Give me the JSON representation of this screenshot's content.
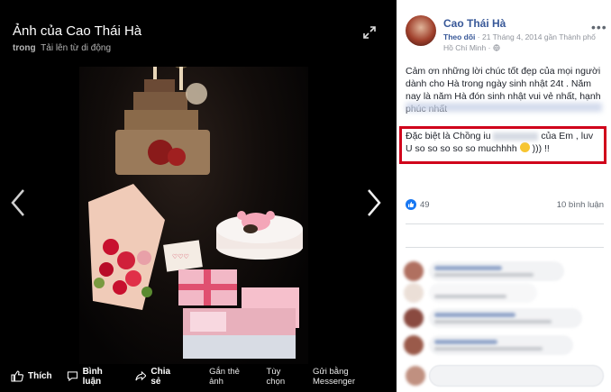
{
  "viewer": {
    "title": "Ảnh của Cao Thái Hà",
    "subtitle_prefix": "trong",
    "subtitle_link": "Tải lên từ di động",
    "actions": {
      "like": "Thích",
      "comment": "Bình luận",
      "share": "Chia sẻ"
    },
    "right_actions": {
      "tag": "Gắn thẻ ảnh",
      "options": "Tùy chọn",
      "messenger": "Gửi bằng Messenger"
    }
  },
  "post": {
    "author": "Cao Thái Hà",
    "follow": "Theo dõi",
    "meta": "· 21 Tháng 4, 2014 gần Thành phố Hồ Chí Minh ·",
    "more": "•••",
    "text": "Cảm ơn những lời chúc tốt đẹp của mọi người dành cho Hà trong ngày sinh nhật 24t . Năm nay là năm Hà đón sinh nhật vui vẻ nhất, hạnh phúc nhất",
    "highlight_part1": "Đặc biệt là Chồng iu",
    "highlight_part2": "của Em , luv U so so so so so muchhhh",
    "highlight_part3": "))) !!",
    "likes": "49",
    "comments": "10 bình luận"
  },
  "colors": {
    "link": "#385898",
    "highlight_border": "#d0021b",
    "like_blue": "#1877f2"
  },
  "icons": [
    "expand-icon",
    "chevron-left-icon",
    "chevron-right-icon",
    "thumbs-up-icon",
    "comment-icon",
    "share-icon",
    "globe-icon",
    "like-reaction-icon",
    "smile-emoji-icon"
  ]
}
